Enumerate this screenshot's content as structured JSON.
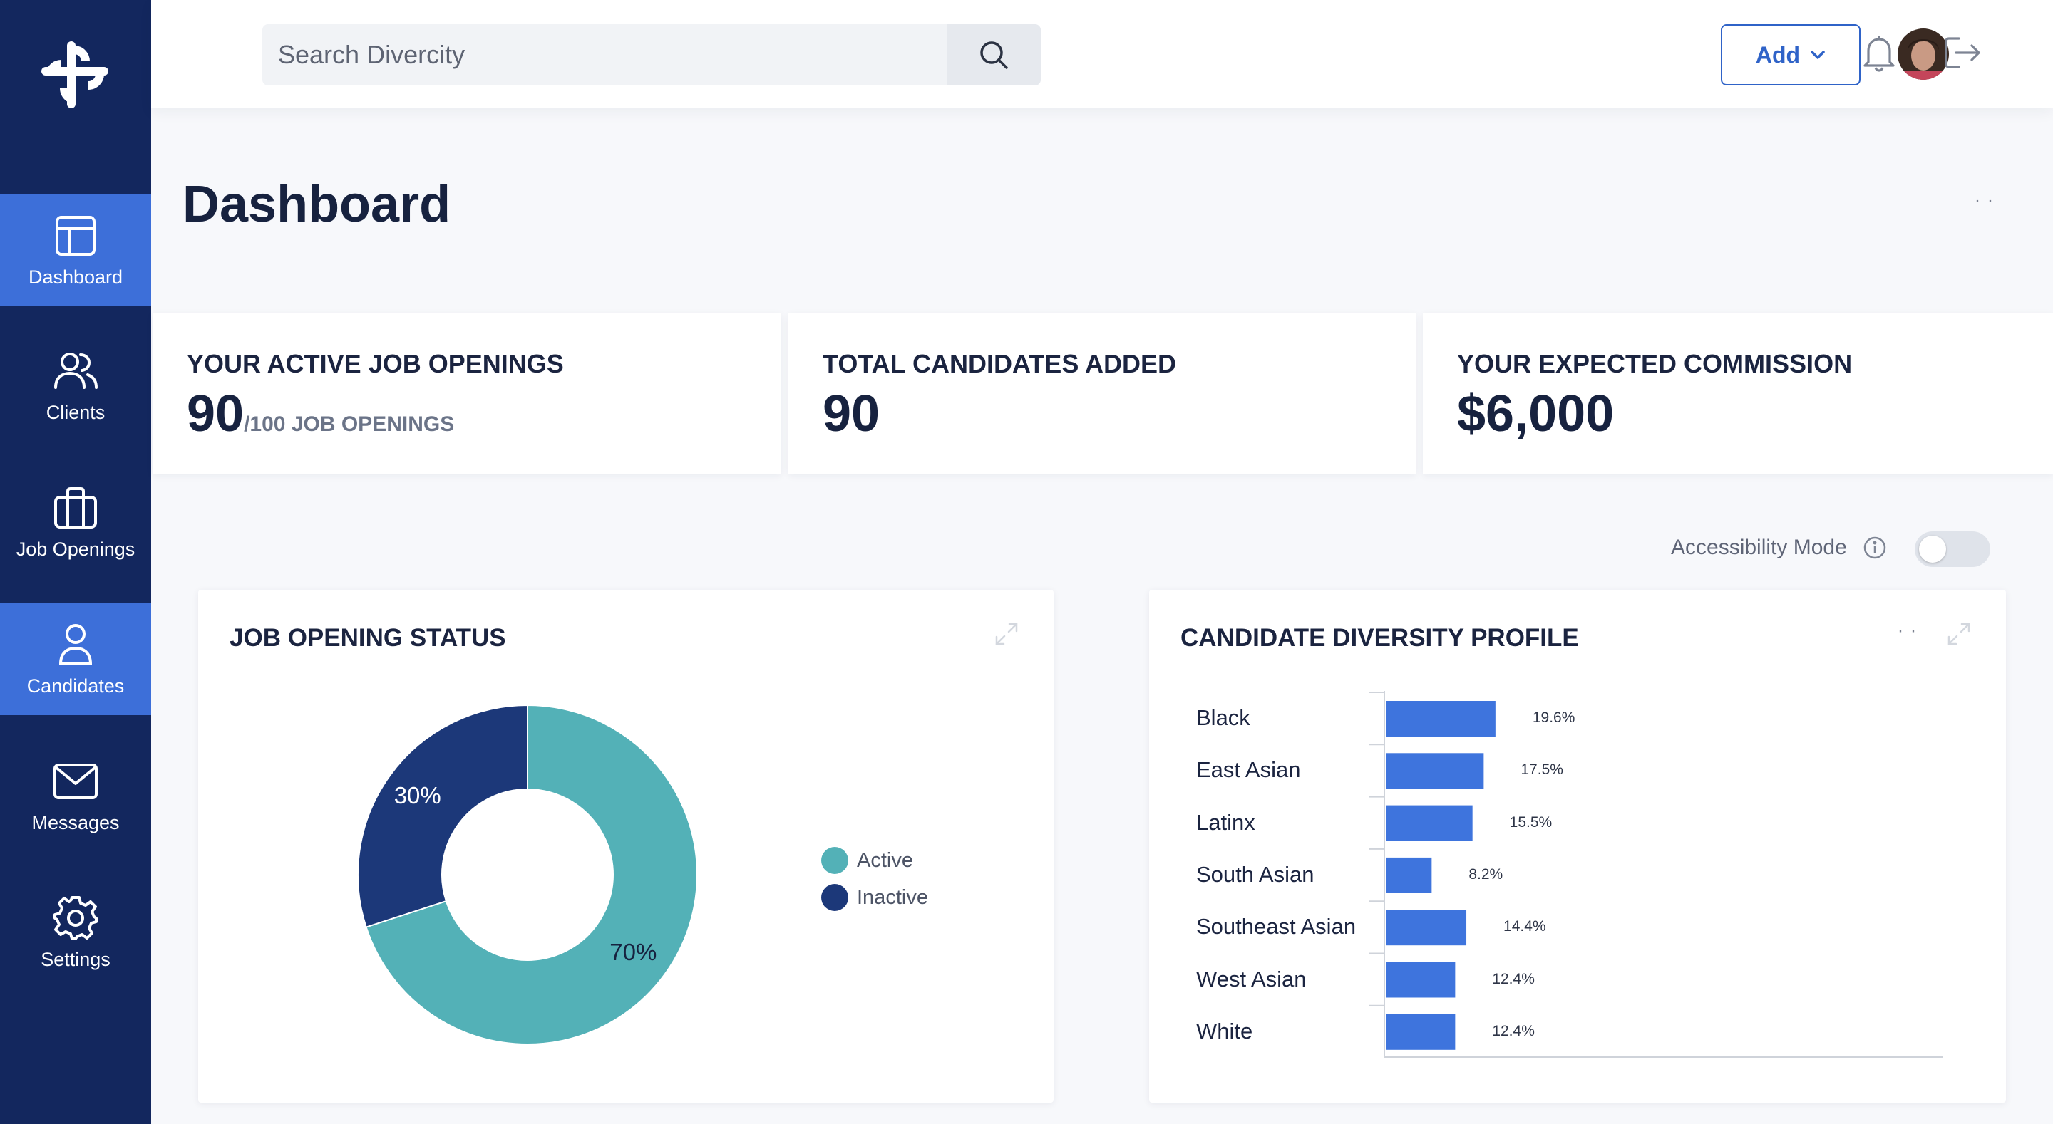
{
  "nav": {
    "items": [
      {
        "label": "Dashboard",
        "active": true,
        "icon": "layout-icon"
      },
      {
        "label": "Clients",
        "active": false,
        "icon": "users-icon"
      },
      {
        "label": "Job Openings",
        "active": false,
        "icon": "briefcase-icon"
      },
      {
        "label": "Candidates",
        "active": true,
        "icon": "user-icon"
      },
      {
        "label": "Messages",
        "active": false,
        "icon": "mail-icon"
      },
      {
        "label": "Settings",
        "active": false,
        "icon": "gear-icon"
      }
    ]
  },
  "header": {
    "search_placeholder": "Search Divercity",
    "add_label": "Add"
  },
  "page": {
    "title": "Dashboard"
  },
  "stats": [
    {
      "label": "YOUR ACTIVE JOB OPENINGS",
      "value": "90",
      "sub": "/100 JOB OPENINGS"
    },
    {
      "label": "TOTAL CANDIDATES ADDED",
      "value": "90"
    },
    {
      "label": "YOUR EXPECTED COMMISSION",
      "value": "$6,000"
    }
  ],
  "accessibility": {
    "label": "Accessibility Mode",
    "enabled": false
  },
  "colors": {
    "sidebar": "#13275e",
    "accent": "#3d6fd9",
    "active_teal": "#53b1b7",
    "inactive_navy": "#1c3879",
    "bar": "#3e74dd"
  },
  "chart_data": [
    {
      "type": "pie",
      "title": "JOB OPENING STATUS",
      "categories": [
        "Active",
        "Inactive"
      ],
      "values": [
        70,
        30
      ],
      "labels": [
        "70%",
        "30%"
      ],
      "legend": "right"
    },
    {
      "type": "bar",
      "orientation": "horizontal",
      "title": "CANDIDATE DIVERSITY PROFILE",
      "categories": [
        "Black",
        "East Asian",
        "Latinx",
        "South Asian",
        "Southeast Asian",
        "West Asian",
        "White"
      ],
      "values": [
        19.6,
        17.5,
        15.5,
        8.2,
        14.4,
        12.4,
        12.4
      ],
      "labels": [
        "19.6%",
        "17.5%",
        "15.5%",
        "8.2%",
        "14.4%",
        "12.4%",
        "12.4%"
      ]
    }
  ]
}
